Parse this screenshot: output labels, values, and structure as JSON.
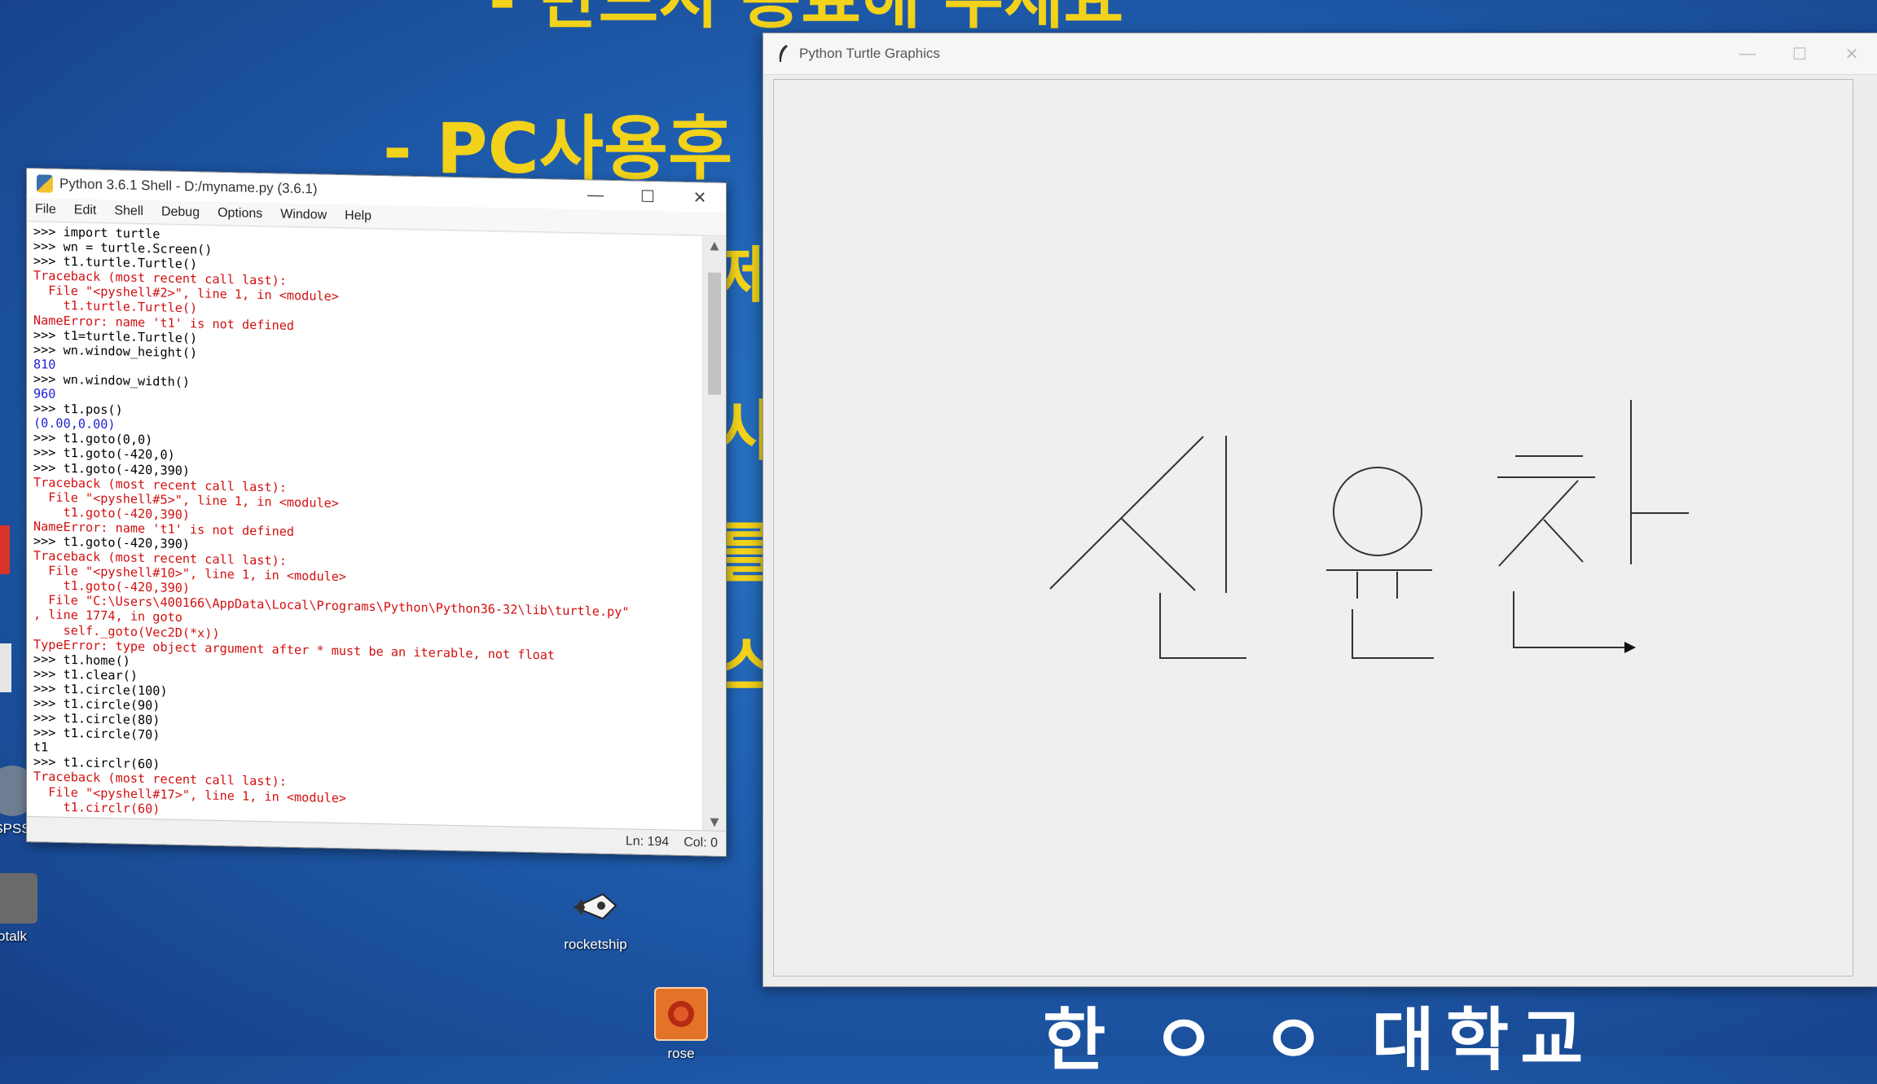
{
  "desktop": {
    "icons": [
      {
        "label": "rocketship"
      },
      {
        "label": "rose"
      },
      {
        "label": "SPSS"
      },
      {
        "label": "otalk"
      }
    ]
  },
  "shell": {
    "title": "Python 3.6.1 Shell - D:/myname.py (3.6.1)",
    "menu": [
      "File",
      "Edit",
      "Shell",
      "Debug",
      "Options",
      "Window",
      "Help"
    ],
    "lines": [
      {
        "t": ">>> import turtle",
        "c": "in"
      },
      {
        "t": ">>> wn = turtle.Screen()",
        "c": "in"
      },
      {
        "t": ">>> t1.turtle.Turtle()",
        "c": "in"
      },
      {
        "t": "Traceback (most recent call last):",
        "c": "err"
      },
      {
        "t": "  File \"<pyshell#2>\", line 1, in <module>",
        "c": "err"
      },
      {
        "t": "    t1.turtle.Turtle()",
        "c": "err"
      },
      {
        "t": "NameError: name 't1' is not defined",
        "c": "err"
      },
      {
        "t": ">>> t1=turtle.Turtle()",
        "c": "in"
      },
      {
        "t": ">>> wn.window_height()",
        "c": "in"
      },
      {
        "t": "810",
        "c": "out"
      },
      {
        "t": ">>> wn.window_width()",
        "c": "in"
      },
      {
        "t": "960",
        "c": "out"
      },
      {
        "t": ">>> t1.pos()",
        "c": "in"
      },
      {
        "t": "(0.00,0.00)",
        "c": "out"
      },
      {
        "t": ">>> t1.goto(0,0)",
        "c": "in"
      },
      {
        "t": ">>> t1.goto(-420,0)",
        "c": "in"
      },
      {
        "t": ">>> t1.goto(-420,390)",
        "c": "in"
      },
      {
        "t": "Traceback (most recent call last):",
        "c": "err"
      },
      {
        "t": "  File \"<pyshell#5>\", line 1, in <module>",
        "c": "err"
      },
      {
        "t": "    t1.goto(-420,390)",
        "c": "err"
      },
      {
        "t": "NameError: name 't1' is not defined",
        "c": "err"
      },
      {
        "t": ">>> t1.goto(-420,390)",
        "c": "in"
      },
      {
        "t": "Traceback (most recent call last):",
        "c": "err"
      },
      {
        "t": "  File \"<pyshell#10>\", line 1, in <module>",
        "c": "err"
      },
      {
        "t": "    t1.goto(-420,390)",
        "c": "err"
      },
      {
        "t": "  File \"C:\\Users\\400166\\AppData\\Local\\Programs\\Python\\Python36-32\\lib\\turtle.py\"",
        "c": "err"
      },
      {
        "t": ", line 1774, in goto",
        "c": "err"
      },
      {
        "t": "    self._goto(Vec2D(*x))",
        "c": "err"
      },
      {
        "t": "TypeError: type object argument after * must be an iterable, not float",
        "c": "err"
      },
      {
        "t": ">>> t1.home()",
        "c": "in"
      },
      {
        "t": ">>> t1.clear()",
        "c": "in"
      },
      {
        "t": ">>> t1.circle(100)",
        "c": "in"
      },
      {
        "t": ">>> t1.circle(90)",
        "c": "in"
      },
      {
        "t": ">>> t1.circle(80)",
        "c": "in"
      },
      {
        "t": ">>> t1.circle(70)",
        "c": "in"
      },
      {
        "t": "t1",
        "c": "in"
      },
      {
        "t": ">>> t1.circlr(60)",
        "c": "in"
      },
      {
        "t": "Traceback (most recent call last):",
        "c": "err"
      },
      {
        "t": "  File \"<pyshell#17>\", line 1, in <module>",
        "c": "err"
      },
      {
        "t": "    t1.circlr(60)",
        "c": "err"
      }
    ],
    "status": {
      "ln": "Ln: 194",
      "col": "Col: 0"
    }
  },
  "turtle": {
    "title": "Python Turtle Graphics"
  },
  "colors": {
    "error": "#d21010",
    "output": "#1e1ed2",
    "wallpaper_text": "#f2d21a"
  }
}
